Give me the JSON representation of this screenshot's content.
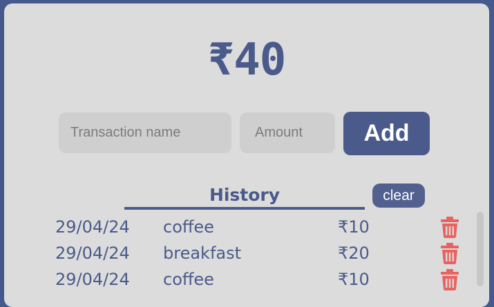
{
  "balance": "₹40",
  "form": {
    "name_placeholder": "Transaction name",
    "amount_placeholder": "Amount",
    "add_label": "Add"
  },
  "history": {
    "title": "History",
    "clear_label": "clear",
    "rows": [
      {
        "date": "29/04/24",
        "name": "coffee",
        "amount": "₹10",
        "icon": "trash-icon"
      },
      {
        "date": "29/04/24",
        "name": "breakfast",
        "amount": "₹20",
        "icon": "trash-icon"
      },
      {
        "date": "29/04/24",
        "name": "coffee",
        "amount": "₹10",
        "icon": "trash-icon"
      }
    ]
  },
  "colors": {
    "frame": "#45598c",
    "card": "#dcdcdc",
    "accent": "#4a5a8a",
    "delete": "#e8625f",
    "input_bg": "#cfcfcf"
  }
}
